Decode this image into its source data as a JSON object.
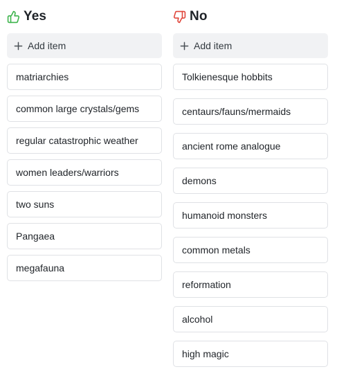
{
  "columns": {
    "yes": {
      "title": "Yes",
      "icon": "thumbs-up-icon",
      "icon_color": "#3bb34a",
      "add_label": "Add item",
      "items": [
        "matriarchies",
        "common large crystals/gems",
        "regular catastrophic weather",
        "women leaders/warriors",
        "two suns",
        "Pangaea",
        "megafauna"
      ]
    },
    "no": {
      "title": "No",
      "icon": "thumbs-down-icon",
      "icon_color": "#e0453a",
      "add_label": "Add item",
      "items": [
        "Tolkienesque hobbits",
        "centaurs/fauns/mermaids",
        "ancient rome analogue",
        "demons",
        "humanoid monsters",
        "common metals",
        "reformation",
        "alcohol",
        "high magic"
      ]
    }
  }
}
